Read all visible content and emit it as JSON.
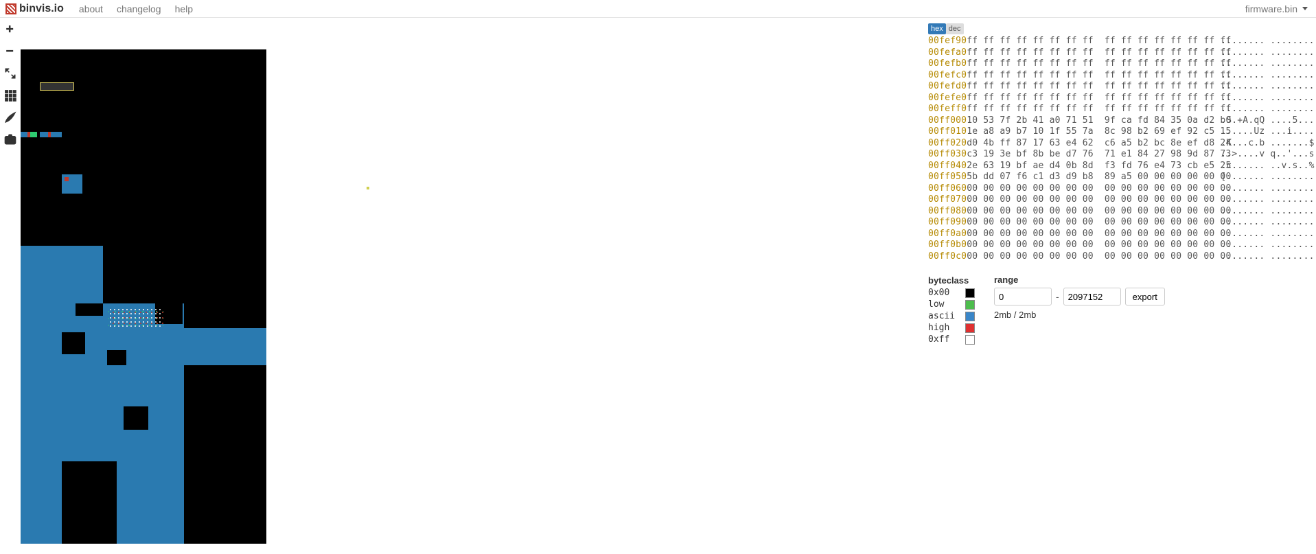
{
  "navbar": {
    "brand": "binvis.io",
    "links": [
      "about",
      "changelog",
      "help"
    ],
    "file": "firmware.bin"
  },
  "hex_toggle": {
    "hex": "hex",
    "dec": "dec",
    "active": "hex"
  },
  "hexdump": [
    {
      "addr": "00fef90",
      "b": "ff ff ff ff ff ff ff ff  ff ff ff ff ff ff ff ff",
      "a": "........ ........"
    },
    {
      "addr": "00fefa0",
      "b": "ff ff ff ff ff ff ff ff  ff ff ff ff ff ff ff ff",
      "a": "........ ........"
    },
    {
      "addr": "00fefb0",
      "b": "ff ff ff ff ff ff ff ff  ff ff ff ff ff ff ff ff",
      "a": "........ ........"
    },
    {
      "addr": "00fefc0",
      "b": "ff ff ff ff ff ff ff ff  ff ff ff ff ff ff ff ff",
      "a": "........ ........"
    },
    {
      "addr": "00fefd0",
      "b": "ff ff ff ff ff ff ff ff  ff ff ff ff ff ff ff ff",
      "a": "........ ........"
    },
    {
      "addr": "00fefe0",
      "b": "ff ff ff ff ff ff ff ff  ff ff ff ff ff ff ff ff",
      "a": "........ ........"
    },
    {
      "addr": "00feff0",
      "b": "ff ff ff ff ff ff ff ff  ff ff ff ff ff ff ff ff",
      "a": "........ ........"
    },
    {
      "addr": "00ff000",
      "b": "10 53 7f 2b 41 a0 71 51  9f ca fd 84 35 0a d2 b0",
      "a": ".S.+A.qQ ....5..."
    },
    {
      "addr": "00ff010",
      "b": "1e a8 a9 b7 10 1f 55 7a  8c 98 b2 69 ef 92 c5 15",
      "a": "......Uz ...i...."
    },
    {
      "addr": "00ff020",
      "b": "d0 4b ff 87 17 63 e4 62  c6 a5 b2 bc 8e ef d8 24",
      "a": ".K...c.b .......$"
    },
    {
      "addr": "00ff030",
      "b": "c3 19 3e bf 8b be d7 76  71 e1 84 27 98 9d 87 73",
      "a": "..>....v q..'...s"
    },
    {
      "addr": "00ff040",
      "b": "2e 63 19 bf ae d4 0b 8d  f3 fd 76 e4 73 cb e5 25",
      "a": ".c...... ..v.s..%"
    },
    {
      "addr": "00ff050",
      "b": "5b dd 07 f6 c1 d3 d9 b8  89 a5 00 00 00 00 00 00",
      "a": "[....... ........"
    },
    {
      "addr": "00ff060",
      "b": "00 00 00 00 00 00 00 00  00 00 00 00 00 00 00 00",
      "a": "........ ........"
    },
    {
      "addr": "00ff070",
      "b": "00 00 00 00 00 00 00 00  00 00 00 00 00 00 00 00",
      "a": "........ ........"
    },
    {
      "addr": "00ff080",
      "b": "00 00 00 00 00 00 00 00  00 00 00 00 00 00 00 00",
      "a": "........ ........"
    },
    {
      "addr": "00ff090",
      "b": "00 00 00 00 00 00 00 00  00 00 00 00 00 00 00 00",
      "a": "........ ........"
    },
    {
      "addr": "00ff0a0",
      "b": "00 00 00 00 00 00 00 00  00 00 00 00 00 00 00 00",
      "a": "........ ........"
    },
    {
      "addr": "00ff0b0",
      "b": "00 00 00 00 00 00 00 00  00 00 00 00 00 00 00 00",
      "a": "........ ........"
    },
    {
      "addr": "00ff0c0",
      "b": "00 00 00 00 00 00 00 00  00 00 00 00 00 00 00 00",
      "a": "........ ........"
    }
  ],
  "byteclass": {
    "heading": "byteclass",
    "rows": [
      {
        "label": "0x00",
        "swatch": "black"
      },
      {
        "label": "low",
        "swatch": "green"
      },
      {
        "label": "ascii",
        "swatch": "blue"
      },
      {
        "label": "high",
        "swatch": "red"
      },
      {
        "label": "0xff",
        "swatch": "white"
      }
    ]
  },
  "range": {
    "heading": "range",
    "start": "0",
    "end": "2097152",
    "sizes": "2mb / 2mb",
    "export": "export"
  },
  "tools": [
    "plus",
    "minus",
    "expand",
    "grid",
    "brush",
    "camera"
  ]
}
